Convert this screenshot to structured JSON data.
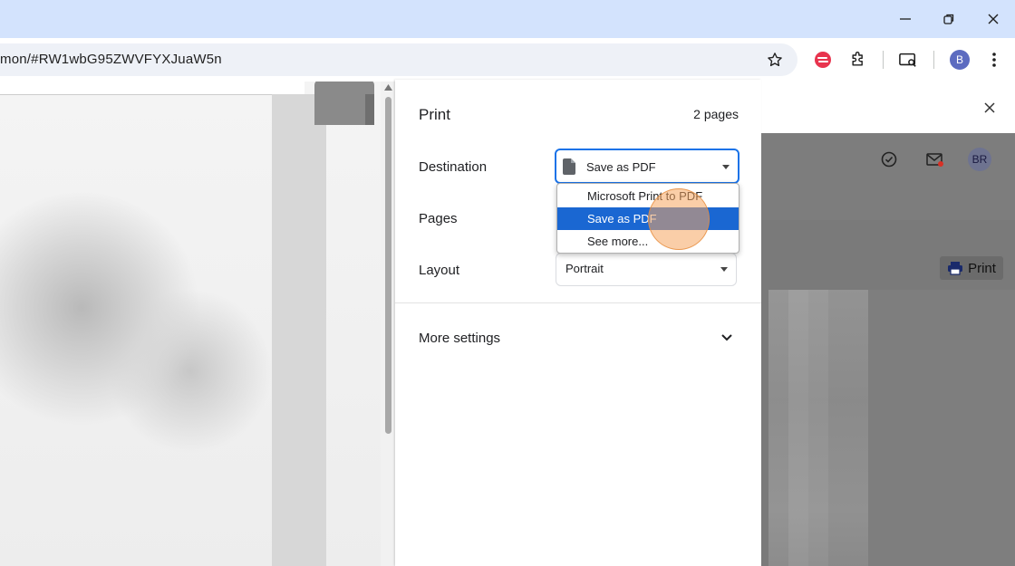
{
  "browser": {
    "url": "mon/#RW1wbG95ZWVFYXJuaW5n",
    "profile_initial": "B",
    "icons": [
      "star-icon",
      "extension-red-icon",
      "puzzle-icon",
      "cast-icon",
      "profile-avatar",
      "more-vert-icon"
    ]
  },
  "window_controls": [
    "minimize-icon",
    "restore-icon",
    "close-icon"
  ],
  "print_dialog": {
    "title": "Print",
    "page_count": "2 pages",
    "destination_label": "Destination",
    "destination_value": "Save as PDF",
    "pages_label": "Pages",
    "layout_label": "Layout",
    "layout_value": "Portrait",
    "more_settings_label": "More settings",
    "dropdown_options": [
      {
        "label": "Microsoft Print to PDF",
        "selected": false
      },
      {
        "label": "Save as PDF",
        "selected": true
      },
      {
        "label": "See more...",
        "selected": false
      }
    ]
  },
  "background_page": {
    "user_initials": "BR",
    "print_button_label": "Print"
  },
  "colors": {
    "accent": "#1a73e8",
    "selected_option": "#1a67d2",
    "titlebar": "#d3e3fd"
  }
}
